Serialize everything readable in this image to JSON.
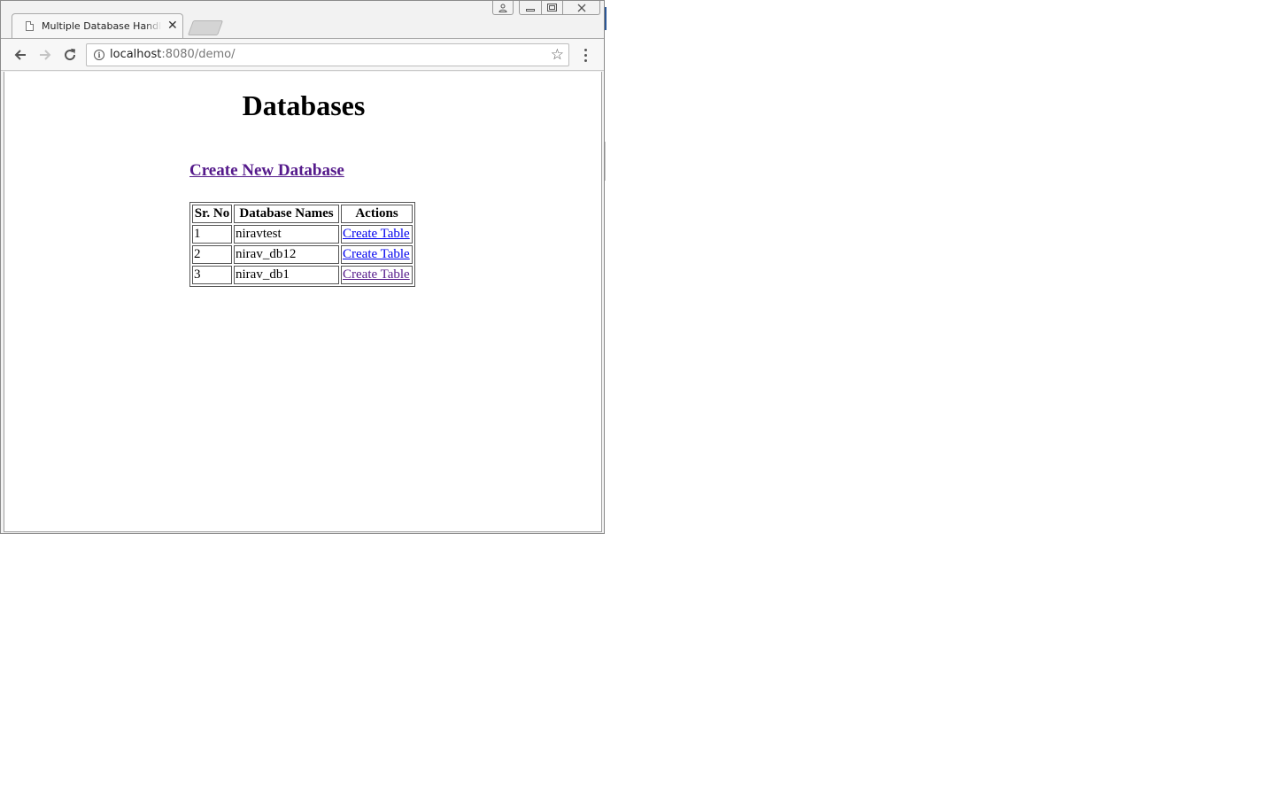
{
  "browser": {
    "tab_title": "Multiple Database Handling I",
    "url_host": "localhost",
    "url_rest": ":8080/demo/"
  },
  "page": {
    "title": "Databases",
    "create_db_link": "Create New Database",
    "table": {
      "headers": [
        "Sr. No",
        "Database Names",
        "Actions"
      ],
      "rows": [
        {
          "sr": "1",
          "name": "niravtest",
          "action": "Create Table"
        },
        {
          "sr": "2",
          "name": "nirav_db12",
          "action": "Create Table"
        },
        {
          "sr": "3",
          "name": "nirav_db1",
          "action": "Create Table"
        }
      ]
    }
  },
  "icons": {
    "back": "arrow-left-icon",
    "forward": "arrow-right-icon",
    "reload": "reload-icon",
    "info": "info-icon",
    "bookmark": "star-icon",
    "menu": "kebab-menu-icon",
    "page": "document-icon"
  },
  "colors": {
    "visited_link": "#551a8b",
    "link": "#0000ee"
  }
}
